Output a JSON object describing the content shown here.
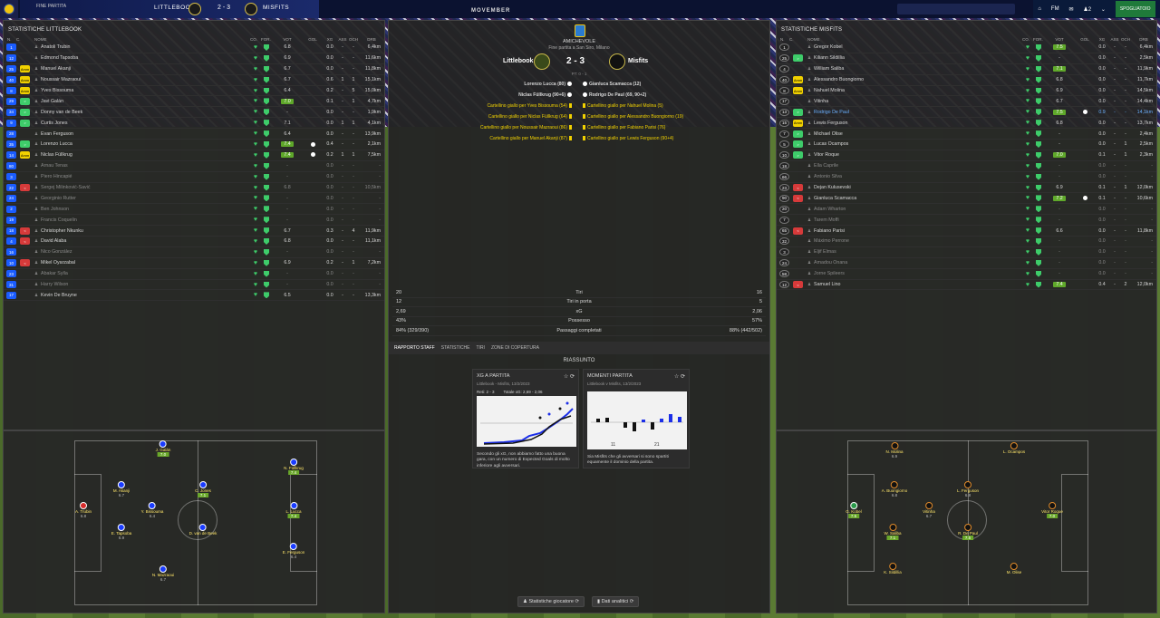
{
  "topbar": {
    "status": "FINE PARTITA",
    "home": "LITTLEBOOK",
    "score": "2 - 3",
    "away": "MISFITS",
    "right_items": [
      "FM",
      "2",
      "SPOGLIATOIO"
    ]
  },
  "ad": "MOVEMBER",
  "left": {
    "title": "STATISTICHE LITTLEBOOK",
    "cols": [
      "N.",
      "C.",
      "NOME",
      "CO.",
      "FOR.",
      "VOT",
      "GOL",
      "XG",
      "ASS",
      "OCH",
      "DRB"
    ],
    "rows": [
      {
        "n": "1",
        "nc": "#1a5cff",
        "c": "",
        "cc": "",
        "name": "Anatoli Trubin",
        "v": "6.8",
        "vg": false,
        "ball": false,
        "xg": "0.0",
        "a": "-",
        "o": "-",
        "d": "6,4km"
      },
      {
        "n": "12",
        "nc": "#1a5cff",
        "c": "",
        "cc": "",
        "name": "Edmond Tapsoba",
        "v": "6.9",
        "vg": false,
        "ball": false,
        "xg": "0.0",
        "a": "-",
        "o": "-",
        "d": "11,6km"
      },
      {
        "n": "25",
        "nc": "#1a5cff",
        "c": "Amm",
        "cc": "#f1d100",
        "name": "Manuel Akanji",
        "v": "6.7",
        "vg": false,
        "ball": false,
        "xg": "0.0",
        "a": "-",
        "o": "-",
        "d": "11,8km"
      },
      {
        "n": "40",
        "nc": "#1a5cff",
        "c": "Amm",
        "cc": "#f1d100",
        "name": "Noussair Mazraoui",
        "v": "6.7",
        "vg": false,
        "ball": false,
        "xg": "0.6",
        "a": "1",
        "o": "1",
        "d": "15,1km"
      },
      {
        "n": "8",
        "nc": "#1a5cff",
        "c": "Amm",
        "cc": "#f1d100",
        "name": "Yves Bissouma",
        "v": "6.4",
        "vg": false,
        "ball": false,
        "xg": "0.2",
        "a": "-",
        "o": "5",
        "d": "15,0km"
      },
      {
        "n": "29",
        "nc": "#1a5cff",
        "c": ">",
        "cc": "#3ecc6a",
        "name": "Javi Galán",
        "v": "7.0",
        "vg": true,
        "ball": false,
        "xg": "0.1",
        "a": "-",
        "o": "1",
        "d": "4,7km"
      },
      {
        "n": "34",
        "nc": "#1a5cff",
        "c": ">",
        "cc": "#3ecc6a",
        "name": "Donny van de Beek",
        "v": "-",
        "vg": false,
        "ball": false,
        "xg": "0.0",
        "a": "-",
        "o": "-",
        "d": "1,9km"
      },
      {
        "n": "9",
        "nc": "#1a5cff",
        "c": ">",
        "cc": "#3ecc6a",
        "name": "Curtis Jones",
        "v": "7.1",
        "vg": false,
        "ball": false,
        "xg": "0.0",
        "a": "1",
        "o": "1",
        "d": "4,1km"
      },
      {
        "n": "28",
        "nc": "#1a5cff",
        "c": "",
        "cc": "",
        "name": "Evan Ferguson",
        "v": "6.4",
        "vg": false,
        "ball": false,
        "xg": "0.0",
        "a": "-",
        "o": "-",
        "d": "13,9km"
      },
      {
        "n": "35",
        "nc": "#1a5cff",
        "c": ">",
        "cc": "#3ecc6a",
        "name": "Lorenzo Lucca",
        "v": "7.4",
        "vg": true,
        "ball": true,
        "xg": "0.4",
        "a": "-",
        "o": "-",
        "d": "2,1km"
      },
      {
        "n": "14",
        "nc": "#1a5cff",
        "c": "Amm",
        "cc": "#f1d100",
        "name": "Niclas Füllkrug",
        "v": "7.4",
        "vg": true,
        "ball": true,
        "xg": "0.2",
        "a": "1",
        "o": "1",
        "d": "7,5km"
      },
      {
        "n": "80",
        "nc": "#1a5cff",
        "c": "",
        "cc": "",
        "name": "Arnau Tenas",
        "v": "-",
        "vg": false,
        "ball": false,
        "xg": "0.0",
        "a": "-",
        "o": "-",
        "d": "-",
        "dim": true
      },
      {
        "n": "3",
        "nc": "#1a5cff",
        "c": "",
        "cc": "",
        "name": "Piero Hincapié",
        "v": "-",
        "vg": false,
        "ball": false,
        "xg": "0.0",
        "a": "-",
        "o": "-",
        "d": "-",
        "dim": true
      },
      {
        "n": "22",
        "nc": "#1a5cff",
        "c": "<",
        "cc": "#d63a3a",
        "name": "Sergej Milinković-Savić",
        "v": "6.8",
        "vg": false,
        "ball": false,
        "xg": "0.0",
        "a": "-",
        "o": "-",
        "d": "10,5km",
        "dim": true
      },
      {
        "n": "24",
        "nc": "#1a5cff",
        "c": "",
        "cc": "",
        "name": "Georginio Rutter",
        "v": "-",
        "vg": false,
        "ball": false,
        "xg": "0.0",
        "a": "-",
        "o": "-",
        "d": "-",
        "dim": true
      },
      {
        "n": "2",
        "nc": "#1a5cff",
        "c": "",
        "cc": "",
        "name": "Ben Johnson",
        "v": "-",
        "vg": false,
        "ball": false,
        "xg": "0.0",
        "a": "-",
        "o": "-",
        "d": "-",
        "dim": true
      },
      {
        "n": "19",
        "nc": "#1a5cff",
        "c": "",
        "cc": "",
        "name": "Francis Coquelin",
        "v": "-",
        "vg": false,
        "ball": false,
        "xg": "0.0",
        "a": "-",
        "o": "-",
        "d": "-",
        "dim": true
      },
      {
        "n": "18",
        "nc": "#1a5cff",
        "c": "<",
        "cc": "#d63a3a",
        "name": "Christopher Nkunku",
        "v": "6.7",
        "vg": false,
        "ball": false,
        "xg": "0.3",
        "a": "-",
        "o": "4",
        "d": "11,9km"
      },
      {
        "n": "4",
        "nc": "#1a5cff",
        "c": "<",
        "cc": "#d63a3a",
        "name": "David Alaba",
        "v": "6.8",
        "vg": false,
        "ball": false,
        "xg": "0.0",
        "a": "-",
        "o": "-",
        "d": "11,1km"
      },
      {
        "n": "16",
        "nc": "#1a5cff",
        "c": "",
        "cc": "",
        "name": "Nico González",
        "v": "-",
        "vg": false,
        "ball": false,
        "xg": "0.0",
        "a": "-",
        "o": "-",
        "d": "-",
        "dim": true
      },
      {
        "n": "10",
        "nc": "#1a5cff",
        "c": "<",
        "cc": "#d63a3a",
        "name": "Mikel Oyarzabal",
        "v": "6.9",
        "vg": false,
        "ball": false,
        "xg": "0.2",
        "a": "-",
        "o": "1",
        "d": "7,2km"
      },
      {
        "n": "23",
        "nc": "#1a5cff",
        "c": "",
        "cc": "",
        "name": "Abakar Sylla",
        "v": "-",
        "vg": false,
        "ball": false,
        "xg": "0.0",
        "a": "-",
        "o": "-",
        "d": "-",
        "dim": true
      },
      {
        "n": "31",
        "nc": "#1a5cff",
        "c": "",
        "cc": "",
        "name": "Harry Wilson",
        "v": "-",
        "vg": false,
        "ball": false,
        "xg": "0.0",
        "a": "-",
        "o": "-",
        "d": "-",
        "dim": true
      },
      {
        "n": "17",
        "nc": "#1a5cff",
        "c": "",
        "cc": "",
        "name": "Kevin De Bruyne",
        "v": "6.5",
        "vg": false,
        "ball": false,
        "xg": "0.0",
        "a": "-",
        "o": "-",
        "d": "13,3km"
      }
    ]
  },
  "right": {
    "title": "STATISTICHE MISFITS",
    "cols": [
      "N.",
      "C.",
      "NOME",
      "CO.",
      "FOR.",
      "VOT",
      "GOL",
      "XG",
      "ASS",
      "OCH",
      "DRB"
    ],
    "rows": [
      {
        "n": "1",
        "nc": "#222",
        "c": "",
        "cc": "",
        "name": "Gregor Kobel",
        "v": "7.5",
        "vg": true,
        "ball": false,
        "xg": "0.0",
        "a": "-",
        "o": "-",
        "d": "6,4km"
      },
      {
        "n": "25",
        "nc": "#222",
        "c": ">",
        "cc": "#3ecc6a",
        "name": "Kiliann Sildillia",
        "v": "-",
        "vg": false,
        "ball": false,
        "xg": "0.0",
        "a": "-",
        "o": "-",
        "d": "2,5km"
      },
      {
        "n": "4",
        "nc": "#222",
        "c": "",
        "cc": "",
        "name": "William Saliba",
        "v": "7.1",
        "vg": true,
        "ball": false,
        "xg": "0.0",
        "a": "-",
        "o": "-",
        "d": "11,9km"
      },
      {
        "n": "40",
        "nc": "#222",
        "c": "Amm",
        "cc": "#f1d100",
        "name": "Alessandro Buongiorno",
        "v": "6.8",
        "vg": false,
        "ball": false,
        "xg": "0.0",
        "a": "-",
        "o": "-",
        "d": "11,7km"
      },
      {
        "n": "8",
        "nc": "#222",
        "c": "Amm",
        "cc": "#f1d100",
        "name": "Nahuel Molina",
        "v": "6.9",
        "vg": false,
        "ball": false,
        "xg": "0.0",
        "a": "-",
        "o": "-",
        "d": "14,5km"
      },
      {
        "n": "17",
        "nc": "#222",
        "c": "",
        "cc": "",
        "name": "Vitinha",
        "v": "6.7",
        "vg": false,
        "ball": false,
        "xg": "0.0",
        "a": "-",
        "o": "-",
        "d": "14,4km"
      },
      {
        "n": "13",
        "nc": "#222",
        "c": ">",
        "cc": "#3ecc6a",
        "name": "Rodrigo De Paul",
        "v": "7.5",
        "vg": true,
        "ball": true,
        "xg": "0.9",
        "a": "-",
        "o": "-",
        "d": "14,1km",
        "hl": true
      },
      {
        "n": "15",
        "nc": "#222",
        "c": "Amm",
        "cc": "#f1d100",
        "name": "Lewis Ferguson",
        "v": "6.8",
        "vg": false,
        "ball": false,
        "xg": "0.0",
        "a": "-",
        "o": "-",
        "d": "13,7km"
      },
      {
        "n": "7",
        "nc": "#222",
        "c": ">",
        "cc": "#3ecc6a",
        "name": "Michael Olise",
        "v": "-",
        "vg": false,
        "ball": false,
        "xg": "0.0",
        "a": "-",
        "o": "-",
        "d": "2,4km"
      },
      {
        "n": "5",
        "nc": "#222",
        "c": ">",
        "cc": "#3ecc6a",
        "name": "Lucas Ocampos",
        "v": "-",
        "vg": false,
        "ball": false,
        "xg": "0.0",
        "a": "-",
        "o": "1",
        "d": "2,5km"
      },
      {
        "n": "10",
        "nc": "#222",
        "c": ">",
        "cc": "#3ecc6a",
        "name": "Vitor Roque",
        "v": "7.0",
        "vg": true,
        "ball": false,
        "xg": "0.1",
        "a": "-",
        "o": "1",
        "d": "2,3km"
      },
      {
        "n": "18",
        "nc": "#222",
        "c": "",
        "cc": "",
        "name": "Ella Caprile",
        "v": "-",
        "vg": false,
        "ball": false,
        "xg": "0.0",
        "a": "-",
        "o": "-",
        "d": "-",
        "dim": true
      },
      {
        "n": "66",
        "nc": "#222",
        "c": "",
        "cc": "",
        "name": "Antonio Silva",
        "v": "-",
        "vg": false,
        "ball": false,
        "xg": "0.0",
        "a": "-",
        "o": "-",
        "d": "-",
        "dim": true
      },
      {
        "n": "23",
        "nc": "#222",
        "c": "<",
        "cc": "#d63a3a",
        "name": "Dejan Kulusevski",
        "v": "6.9",
        "vg": false,
        "ball": false,
        "xg": "0.1",
        "a": "-",
        "o": "1",
        "d": "12,0km"
      },
      {
        "n": "90",
        "nc": "#222",
        "c": "<",
        "cc": "#d63a3a",
        "name": "Gianluca Scamacca",
        "v": "7.2",
        "vg": true,
        "ball": true,
        "xg": "0.1",
        "a": "-",
        "o": "-",
        "d": "10,6km"
      },
      {
        "n": "20",
        "nc": "#222",
        "c": "",
        "cc": "",
        "name": "Adam Wharton",
        "v": "-",
        "vg": false,
        "ball": false,
        "xg": "0.0",
        "a": "-",
        "o": "-",
        "d": "-",
        "dim": true
      },
      {
        "n": "7",
        "nc": "#222",
        "c": "",
        "cc": "",
        "name": "Tarem Moffi",
        "v": "-",
        "vg": false,
        "ball": false,
        "xg": "0.0",
        "a": "-",
        "o": "-",
        "d": "-",
        "dim": true
      },
      {
        "n": "65",
        "nc": "#222",
        "c": "<",
        "cc": "#d63a3a",
        "name": "Fabiano Parisi",
        "v": "6.6",
        "vg": false,
        "ball": false,
        "xg": "0.0",
        "a": "-",
        "o": "-",
        "d": "11,8km"
      },
      {
        "n": "32",
        "nc": "#222",
        "c": "",
        "cc": "",
        "name": "Máximo Perrone",
        "v": "-",
        "vg": false,
        "ball": false,
        "xg": "0.0",
        "a": "-",
        "o": "-",
        "d": "-",
        "dim": true
      },
      {
        "n": "3",
        "nc": "#222",
        "c": "",
        "cc": "",
        "name": "Eljif Elmas",
        "v": "-",
        "vg": false,
        "ball": false,
        "xg": "0.0",
        "a": "-",
        "o": "-",
        "d": "-",
        "dim": true
      },
      {
        "n": "24",
        "nc": "#222",
        "c": "",
        "cc": "",
        "name": "Amadou Onana",
        "v": "-",
        "vg": false,
        "ball": false,
        "xg": "0.0",
        "a": "-",
        "o": "-",
        "d": "-",
        "dim": true
      },
      {
        "n": "58",
        "nc": "#222",
        "c": "",
        "cc": "",
        "name": "Jorne Spileers",
        "v": "-",
        "vg": false,
        "ball": false,
        "xg": "0.0",
        "a": "-",
        "o": "-",
        "d": "-",
        "dim": true
      },
      {
        "n": "12",
        "nc": "#222",
        "c": "<",
        "cc": "#d63a3a",
        "name": "Samuel Lino",
        "v": "7.4",
        "vg": true,
        "ball": false,
        "xg": "0.4",
        "a": "-",
        "o": "2",
        "d": "12,0km"
      }
    ]
  },
  "center": {
    "comp": "AMICHEVOLE",
    "venue": "Fine partita a San Siro, Milano",
    "home": "Littlebook",
    "away": "Misfits",
    "score": "2 - 3",
    "pt": "PT: 0 - 1",
    "goals": [
      {
        "l": "Lorenzo Lucca (80)",
        "r": "Gianluca Scamacca (12)"
      },
      {
        "l": "Niclas Füllkrug (90+6)",
        "r": "Rodrigo De Paul (69, 90+2)"
      }
    ],
    "cards": [
      {
        "l": "Cartellino giallo per Yves Bissouma (54)",
        "r": "Cartellino giallo per Nahuel Molina (5)"
      },
      {
        "l": "Cartellino giallo per Niclas Füllkrug (64)",
        "r": "Cartellino giallo per Alessandro Buongiorno (19)"
      },
      {
        "l": "Cartellino giallo per Noussair Mazraoui (86)",
        "r": "Cartellino giallo per Fabiano Parisi (76)"
      },
      {
        "l": "Cartellino giallo per Manuel Akanji (87)",
        "r": "Cartellino giallo per Lewis Ferguson (90+4)"
      }
    ],
    "stats": [
      {
        "a": "20",
        "m": "Tiri",
        "b": "16"
      },
      {
        "a": "12",
        "m": "Tiri in porta",
        "b": "5"
      },
      {
        "a": "2,69",
        "m": "xG",
        "b": "2,06"
      },
      {
        "a": "43%",
        "m": "Possesso",
        "b": "57%"
      },
      {
        "a": "84% (329/390)",
        "m": "Passaggi completati",
        "b": "88% (442/502)"
      }
    ],
    "tabs": [
      "RAPPORTO STAFF",
      "STATISTICHE",
      "TIRI",
      "ZONE DI COPERTURA"
    ],
    "summary": "RIASSUNTO",
    "card1": {
      "title": "XG A PARTITA",
      "sub": "Littlebook - Misfits, 13/2/2023",
      "chip1": "Reti: 2 - 3",
      "chip2": "Totale xG: 2,69 - 2,06",
      "text": "Secondo gli xG, non abbiamo fatto una buona gara, con un numero di Expected Goals di molto inferiore agli avversari."
    },
    "card2": {
      "title": "MOMENTI PARTITA",
      "sub": "Littlebook v Misfits, 13/2/2023",
      "t1": "11",
      "t2": "21",
      "text": "Sia Misfits che gli avversari si sono spartiti equamente il dominio della partita."
    },
    "btn1": "Statistiche giocatore",
    "btn2": "Dati analitici"
  },
  "pitch_left": [
    {
      "name": "J. Galán",
      "r": "7.0",
      "g": true
    },
    {
      "name": "M. Akanji",
      "r": "6.7"
    },
    {
      "name": "C. Jones",
      "r": "7.1",
      "g": true
    },
    {
      "name": "N. Füllkrug",
      "r": "7.4",
      "g": true
    },
    {
      "name": "A. Trubin",
      "r": "6.8"
    },
    {
      "name": "Y. Bissouma",
      "r": "6.4"
    },
    {
      "name": "L. Lucca",
      "r": "7.4",
      "g": true
    },
    {
      "name": "E. Tapsoba",
      "r": "6.9"
    },
    {
      "name": "D. van de Beek",
      "r": ""
    },
    {
      "name": "E. Ferguson",
      "r": "6.4"
    },
    {
      "name": "N. Mazraoui",
      "r": "6.7"
    }
  ],
  "pitch_right": [
    {
      "name": "N. Molina",
      "r": "6.9"
    },
    {
      "name": "L. Ocampos",
      "r": ""
    },
    {
      "name": "A. Buongiorno",
      "r": "6.8"
    },
    {
      "name": "L. Ferguson",
      "r": "6.8"
    },
    {
      "name": "G. Kobel",
      "r": "7.5",
      "g": true
    },
    {
      "name": "Vitinha",
      "r": "6.7"
    },
    {
      "name": "Vitor Roque",
      "r": "7.0",
      "g": true
    },
    {
      "name": "W. Saliba",
      "r": "7.1",
      "g": true
    },
    {
      "name": "R. De Paul",
      "r": "7.5",
      "g": true
    },
    {
      "name": "K. Sildillia",
      "r": ""
    },
    {
      "name": "M. Olise",
      "r": ""
    }
  ]
}
